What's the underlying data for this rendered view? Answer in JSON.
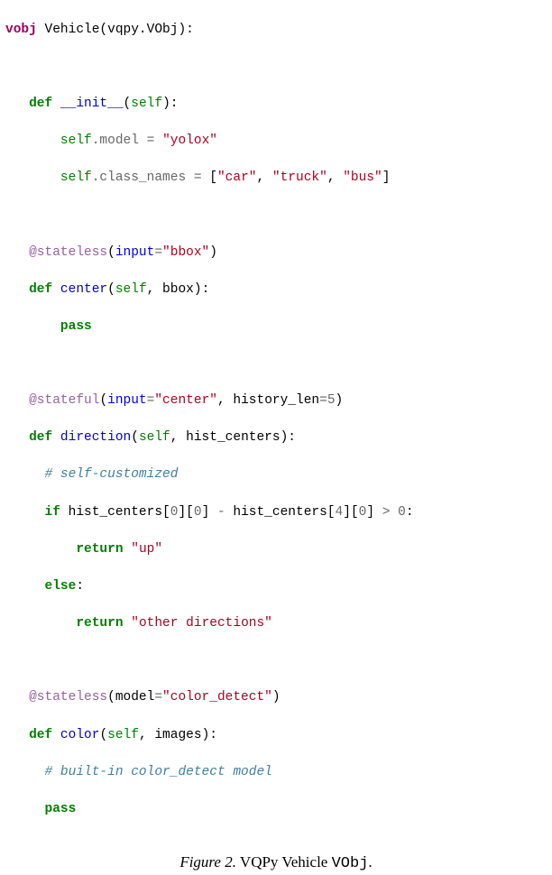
{
  "code": {
    "line01_vobj": "vobj",
    "line01_class": " Vehicle(vqpy.VObj):",
    "line03_def": "def",
    "line03_fn": " __init__",
    "line03_rest": "(",
    "line03_self": "self",
    "line03_close": "):",
    "line04_self": "self",
    "line04_attr": ".model ",
    "line04_eq": "= ",
    "line04_str": "\"yolox\"",
    "line05_self": "self",
    "line05_attr": ".class_names ",
    "line05_eq": "= ",
    "line05_lb": "[",
    "line05_s1": "\"car\"",
    "line05_c1": ", ",
    "line05_s2": "\"truck\"",
    "line05_c2": ", ",
    "line05_s3": "\"bus\"",
    "line05_rb": "]",
    "line07_dec": "@stateless",
    "line07_rest_a": "(",
    "line07_kw": "input",
    "line07_eq": "=",
    "line07_str": "\"bbox\"",
    "line07_rest_b": ")",
    "line08_def": "def",
    "line08_fn": " center",
    "line08_open": "(",
    "line08_self": "self",
    "line08_rest": ", bbox):",
    "line09_pass": "pass",
    "line11_dec": "@stateful",
    "line11_open": "(",
    "line11_kw": "input",
    "line11_eq": "=",
    "line11_str": "\"center\"",
    "line11_comma": ", history_len",
    "line11_eq2": "=",
    "line11_num": "5",
    "line11_close": ")",
    "line12_def": "def",
    "line12_fn": " direction",
    "line12_open": "(",
    "line12_self": "self",
    "line12_rest": ", hist_centers):",
    "line13_comment": "# self-customized",
    "line14_if": "if",
    "line14_a": " hist_centers[",
    "line14_n0a": "0",
    "line14_b": "][",
    "line14_n0b": "0",
    "line14_c": "] ",
    "line14_minus": "- ",
    "line14_d": "hist_centers[",
    "line14_n4": "4",
    "line14_e": "][",
    "line14_n0c": "0",
    "line14_f": "] ",
    "line14_gt": "> ",
    "line14_n0d": "0",
    "line14_colon": ":",
    "line15_return": "return",
    "line15_sp": " ",
    "line15_str": "\"up\"",
    "line16_else": "else",
    "line16_colon": ":",
    "line17_return": "return",
    "line17_sp": " ",
    "line17_str": "\"other directions\"",
    "line19_dec": "@stateless",
    "line19_open": "(",
    "line19_kw": "model",
    "line19_eq": "=",
    "line19_str": "\"color_detect\"",
    "line19_close": ")",
    "line20_def": "def",
    "line20_fn": " color",
    "line20_open": "(",
    "line20_self": "self",
    "line20_rest": ", images):",
    "line21_comment": "# built-in color_detect model",
    "line22_pass": "pass"
  },
  "caption": {
    "prefix": "Figure 2.",
    "mid": " VQPy Vehicle ",
    "mono": "VObj",
    "suffix": "."
  }
}
